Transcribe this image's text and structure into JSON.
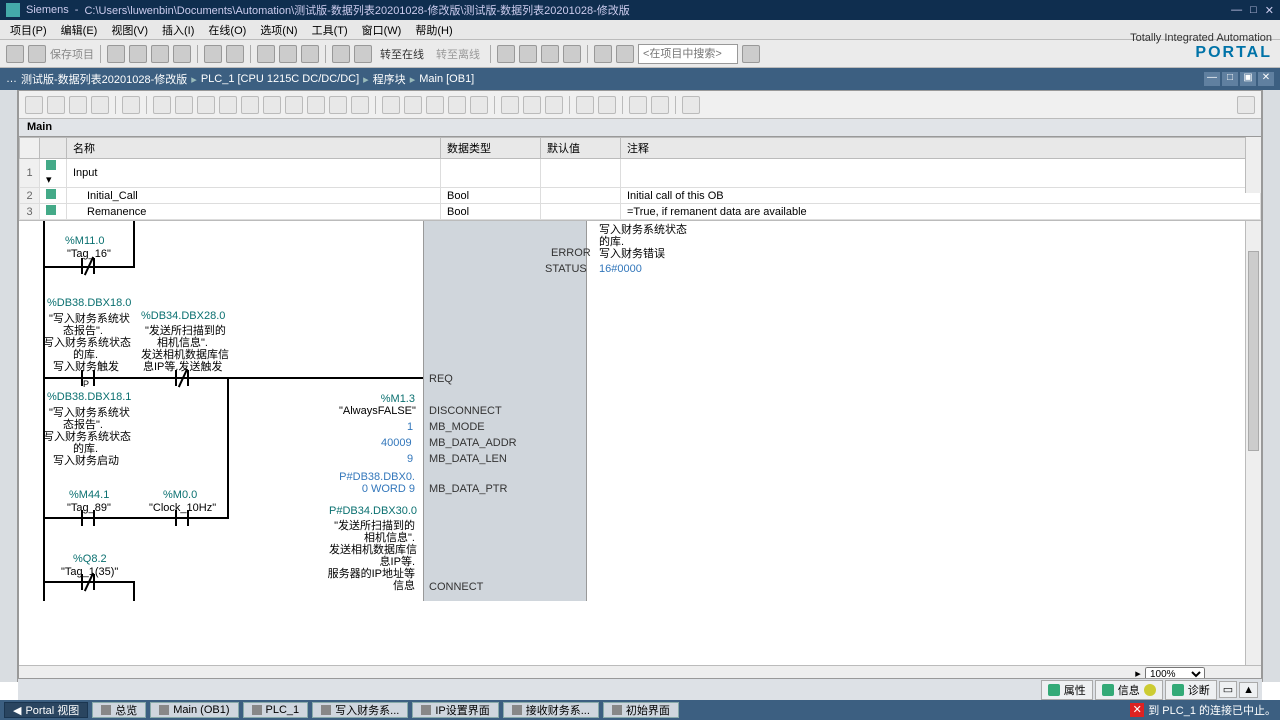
{
  "titlebar": {
    "app": "Siemens",
    "path": "C:\\Users\\luwenbin\\Documents\\Automation\\测试版-数据列表20201028-修改版\\测试版-数据列表20201028-修改版"
  },
  "menubar": [
    "项目(P)",
    "编辑(E)",
    "视图(V)",
    "插入(I)",
    "在线(O)",
    "选项(N)",
    "工具(T)",
    "窗口(W)",
    "帮助(H)"
  ],
  "toolbar": {
    "save": "保存项目",
    "go_online": "转至在线",
    "go_offline": "转至离线",
    "search_ph": "<在项目中搜索>"
  },
  "portal": {
    "line1": "Totally Integrated Automation",
    "line2": "PORTAL"
  },
  "breadcrumb": [
    "测试版-数据列表20201028-修改版",
    "PLC_1 [CPU 1215C DC/DC/DC]",
    "程序块",
    "Main [OB1]"
  ],
  "interface": {
    "title": "Main",
    "cols": [
      "名称",
      "数据类型",
      "默认值",
      "注释"
    ],
    "rows": [
      {
        "n": "1",
        "name": "Input",
        "type": "",
        "def": "",
        "comment": "",
        "expand": true
      },
      {
        "n": "2",
        "name": "Initial_Call",
        "type": "Bool",
        "def": "",
        "comment": "Initial call of this OB"
      },
      {
        "n": "3",
        "name": "Remanence",
        "type": "Bool",
        "def": "",
        "comment": "=True, if remanent data are available"
      }
    ]
  },
  "ladder": {
    "m11_0": "%M11.0",
    "tag16": "\"Tag_16\"",
    "db38_18_0": "%DB38.DBX18.0",
    "db38_18_0_t1": "\"写入财务系统状",
    "db38_18_0_t2": "态报告\".",
    "db38_18_0_t3": "写入财务系统状态",
    "db38_18_0_t4": "的库.",
    "db38_18_0_t5": "写入财务触发",
    "db34_28_0": "%DB34.DBX28.0",
    "db34_28_0_t1": "\"发送所扫描到的",
    "db34_28_0_t2": "相机信息\".",
    "db34_28_0_t3": "发送相机数据库信",
    "db34_28_0_t4": "息IP等.发送触发",
    "db38_18_1": "%DB38.DBX18.1",
    "db38_18_1_t1": "\"写入财务系统状",
    "db38_18_1_t2": "态报告\".",
    "db38_18_1_t3": "写入财务系统状态",
    "db38_18_1_t4": "的库.",
    "db38_18_1_t5": "写入财务启动",
    "m44_1": "%M44.1",
    "tag89": "\"Tag_89\"",
    "m0_0": "%M0.0",
    "clock10": "\"Clock_10Hz\"",
    "q8_2": "%Q8.2",
    "tag135": "\"Tag_1(35)\"",
    "req": "REQ",
    "m1_3": "%M1.3",
    "alwaysFalse": "\"AlwaysFALSE\"",
    "disconnect": "DISCONNECT",
    "one": "1",
    "mb_mode": "MB_MODE",
    "v40009": "40009",
    "mb_data_addr": "MB_DATA_ADDR",
    "nine": "9",
    "mb_data_len": "MB_DATA_LEN",
    "ptr1": "P#DB38.DBX0.",
    "ptr2": "0 WORD 9",
    "mb_data_ptr": "MB_DATA_PTR",
    "db34_30_0": "P#DB34.DBX30.0",
    "db34_30_0_t1": "\"发送所扫描到的",
    "db34_30_0_t2": "相机信息\".",
    "db34_30_0_t3": "发送相机数据库信",
    "db34_30_0_t4": "息IP等.",
    "db34_30_0_t5": "服务器的IP地址等",
    "db34_30_0_t6": "信息",
    "connect": "CONNECT",
    "error": "ERROR",
    "err_t1": "写入财务系统状态",
    "err_t2": "的库.",
    "err_t3": "写入财务错误",
    "status": "STATUS",
    "status_v": "16#0000"
  },
  "props": {
    "p": "属性",
    "i": "信息",
    "d": "诊断"
  },
  "zoom": "100%",
  "taskbar": {
    "portal_view": "Portal 视图",
    "overview": "总览",
    "main_ob1": "Main (OB1)",
    "plc1": "PLC_1",
    "t1": "写入财务系...",
    "t2": "IP设置界面",
    "t3": "接收财务系...",
    "t4": "初始界面",
    "status": "到 PLC_1 的连接已中止。"
  }
}
